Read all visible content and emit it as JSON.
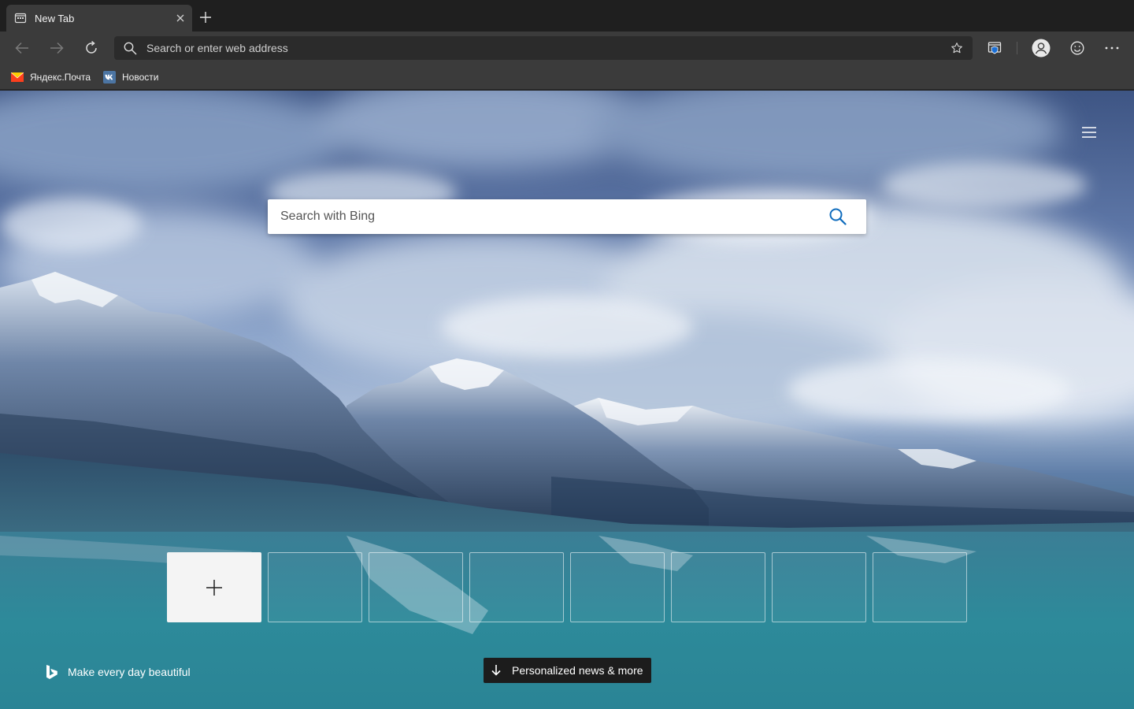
{
  "colors": {
    "tab_active_bg": "#3b3b3b",
    "toolbar_bg": "#3b3b3b",
    "tabstrip_bg": "#1f1f1f",
    "addressbar_bg": "#2b2b2b",
    "bing_accent": "#0f6cbd",
    "yandex_red": "#fc3f1d",
    "yandex_yellow": "#ffcc00",
    "vk_blue": "#4c75a3"
  },
  "tab": {
    "title": "New Tab",
    "favicon": "newtab-page-icon",
    "close_icon": "close-icon"
  },
  "new_tab_button": {
    "icon": "plus-icon"
  },
  "toolbar": {
    "back_icon": "arrow-left-icon",
    "forward_icon": "arrow-right-icon",
    "refresh_icon": "refresh-icon",
    "address": {
      "placeholder": "Search or enter web address",
      "value": "",
      "search_icon": "search-icon",
      "favorite_icon": "star-icon"
    },
    "extension_icon": "collections-shield-icon",
    "profile_icon": "avatar-icon",
    "feedback_icon": "smiley-icon",
    "more_icon": "ellipsis-icon"
  },
  "favorites": [
    {
      "label": "Яндекс.Почта",
      "icon": "yandex-mail-icon"
    },
    {
      "label": "Новости",
      "icon": "vk-icon"
    }
  ],
  "newtab": {
    "menu_icon": "hamburger-icon",
    "search": {
      "placeholder": "Search with Bing",
      "icon": "search-icon"
    },
    "tiles": {
      "add_icon": "plus-icon",
      "empty_count": 7
    },
    "bing_credit": {
      "label": "Make every day beautiful",
      "icon": "bing-logo-icon"
    },
    "news_button": {
      "label": "Personalized news & more",
      "icon": "arrow-down-icon"
    }
  }
}
